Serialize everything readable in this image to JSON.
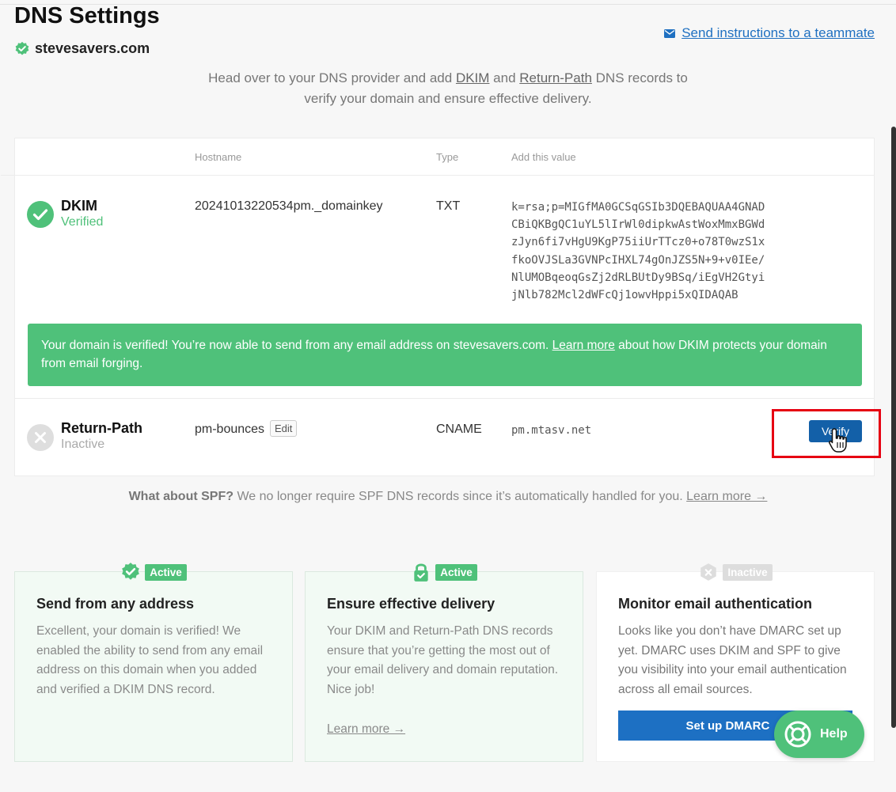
{
  "header": {
    "title": "DNS Settings",
    "domain": "stevesavers.com",
    "send_instructions": "Send instructions to a teammate"
  },
  "intro": {
    "part1": "Head over to your DNS provider and add ",
    "dkim": "DKIM",
    "and": " and ",
    "return_path": "Return-Path",
    "part2": " DNS records to",
    "line2": "verify your domain and ensure effective delivery."
  },
  "table": {
    "col_hostname": "Hostname",
    "col_type": "Type",
    "col_value": "Add this value"
  },
  "dkim": {
    "name": "DKIM",
    "status": "Verified",
    "hostname": "20241013220534pm._domainkey",
    "type": "TXT",
    "value": "k=rsa;p=MIGfMA0GCSqGSIb3DQEBAQUAA4GNAD\nCBiQKBgQC1uYL5lIrWl0dipkwAstWoxMmxBGWd\nzJyn6fi7vHgU9KgP75iiUrTTcz0+o78T0wzS1x\nfkoOVJSLa3GVNPcIHXL74gOnJZS5N+9+v0IEe/\nNlUMOBqeoqGsZj2dRLBUtDy9BSq/iEgVH2Gtyi\njNlb782Mcl2dWFcQj1owvHppi5xQIDAQAB",
    "banner_part1": "Your domain is verified! You’re now able to send from any email address on stevesavers.com. ",
    "banner_link": "Learn more",
    "banner_part2": " about how DKIM protects your domain from email forging."
  },
  "return_path": {
    "name": "Return-Path",
    "status": "Inactive",
    "hostname": "pm-bounces",
    "edit": "Edit",
    "type": "CNAME",
    "value": "pm.mtasv.net",
    "verify": "Verify"
  },
  "spf": {
    "bold": "What about SPF?",
    "text": " We no longer require SPF DNS records since it’s automatically handled for you. ",
    "link": "Learn more →"
  },
  "features": [
    {
      "badge": "Active",
      "title": "Send from any address",
      "text": "Excellent, your domain is verified! We enabled the ability to send from any email address on this domain when you added and verified a DKIM DNS record."
    },
    {
      "badge": "Active",
      "title": "Ensure effective delivery",
      "text": "Your DKIM and Return-Path DNS records ensure that you’re getting the most out of your email delivery and domain reputation. Nice job!",
      "link": "Learn more →"
    },
    {
      "badge": "Inactive",
      "title": "Monitor email authentication",
      "text": "Looks like you don’t have DMARC set up yet. DMARC uses DKIM and SPF to give you visibility into your email authentication across all email sources.",
      "button": "Set up DMARC →"
    }
  ],
  "help": {
    "label": "Help"
  },
  "colors": {
    "green": "#4fc17a",
    "blue": "#1d70c3",
    "verify_blue": "#1360a8",
    "highlight_red": "#e60012"
  }
}
